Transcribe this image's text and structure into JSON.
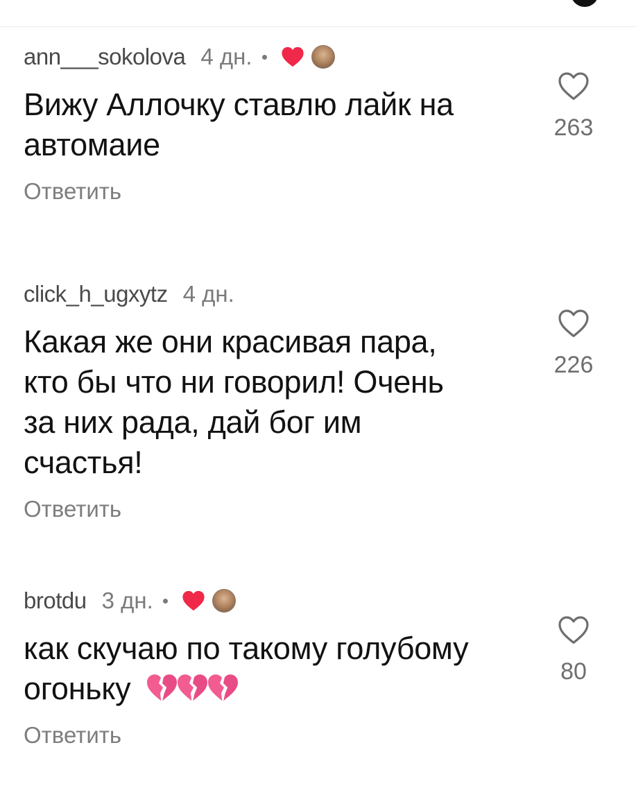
{
  "comments": [
    {
      "username": "ann___sokolova",
      "time": "4 дн.",
      "author_liked": true,
      "text_lines": [
        "Вижу Аллочку ставлю лайк на",
        "автомаие"
      ],
      "reply_label": "Ответить",
      "like_count": "263"
    },
    {
      "username": "click_h_ugxytz",
      "time": "4 дн.",
      "author_liked": false,
      "text_lines": [
        "Какая же они красивая пара,",
        "кто бы что ни говорил! Очень",
        "за них рада, дай бог им",
        "счастья!"
      ],
      "reply_label": "Ответить",
      "like_count": "226"
    },
    {
      "username": "brotdu",
      "time": "3 дн.",
      "author_liked": true,
      "text_lines": [
        "как скучаю по такому голубому",
        "огоньку"
      ],
      "emoji": "broken-heart x3",
      "reply_label": "Ответить",
      "like_count": "80"
    }
  ],
  "colors": {
    "liked_heart": "#f02849",
    "broken_heart": "#f25c91",
    "meta_text": "#7a7a7a",
    "body_text": "#121212"
  }
}
